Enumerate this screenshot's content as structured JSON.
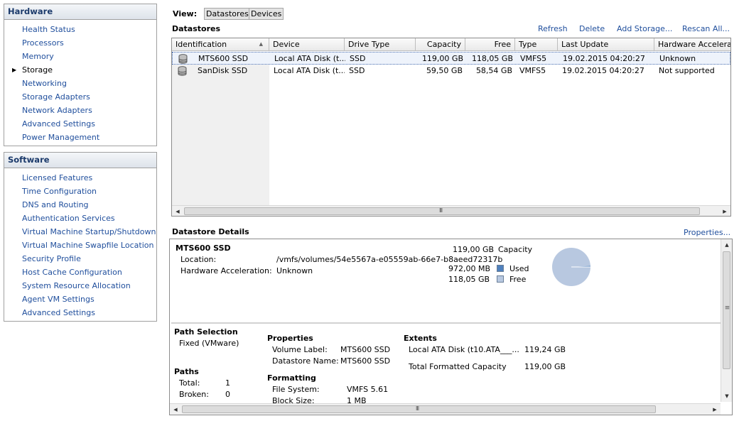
{
  "colors": {
    "link": "#1f4e9c",
    "used": "#4f81bd",
    "free": "#b8c8e0",
    "pie": "#b8c8e0"
  },
  "hardware": {
    "title": "Hardware",
    "items": [
      {
        "label": "Health Status"
      },
      {
        "label": "Processors"
      },
      {
        "label": "Memory"
      },
      {
        "label": "Storage",
        "active": true
      },
      {
        "label": "Networking"
      },
      {
        "label": "Storage Adapters"
      },
      {
        "label": "Network Adapters"
      },
      {
        "label": "Advanced Settings"
      },
      {
        "label": "Power Management"
      }
    ]
  },
  "software": {
    "title": "Software",
    "items": [
      {
        "label": "Licensed Features"
      },
      {
        "label": "Time Configuration"
      },
      {
        "label": "DNS and Routing"
      },
      {
        "label": "Authentication Services"
      },
      {
        "label": "Virtual Machine Startup/Shutdown"
      },
      {
        "label": "Virtual Machine Swapfile Location"
      },
      {
        "label": "Security Profile"
      },
      {
        "label": "Host Cache Configuration"
      },
      {
        "label": "System Resource Allocation"
      },
      {
        "label": "Agent VM Settings"
      },
      {
        "label": "Advanced Settings"
      }
    ]
  },
  "view": {
    "label": "View:",
    "datastores": "Datastores",
    "devices": "Devices"
  },
  "datastores": {
    "title": "Datastores",
    "actions": {
      "refresh": "Refresh",
      "delete": "Delete",
      "add_storage": "Add Storage...",
      "rescan": "Rescan All..."
    },
    "columns": [
      "Identification",
      "Device",
      "Drive Type",
      "Capacity",
      "Free",
      "Type",
      "Last Update",
      "Hardware Accelerat"
    ],
    "rows": [
      [
        "MTS600 SSD",
        "Local ATA Disk (t...",
        "SSD",
        "119,00 GB",
        "118,05 GB",
        "VMFS5",
        "19.02.2015 04:20:27",
        "Unknown"
      ],
      [
        "SanDisk SSD",
        "Local ATA Disk (t...",
        "SSD",
        "59,50 GB",
        "58,54 GB",
        "VMFS5",
        "19.02.2015 04:20:27",
        "Not supported"
      ]
    ],
    "scroll_grip": "III"
  },
  "details": {
    "title": "Datastore Details",
    "properties_link": "Properties...",
    "name": "MTS600 SSD",
    "location_label": "Location:",
    "location_value": "/vmfs/volumes/54e5567a-e05559ab-66e7-b8aeed72317b",
    "hwaccel_label": "Hardware Acceleration:",
    "hwaccel_value": "Unknown",
    "capacity_value": "119,00 GB",
    "capacity_label": "Capacity",
    "used_value": "972,00 MB",
    "used_label": "Used",
    "free_value": "118,05 GB",
    "free_label": "Free",
    "used_fraction": 0.008,
    "path_selection_title": "Path Selection",
    "path_selection_value": "Fixed (VMware)",
    "paths_title": "Paths",
    "total_label": "Total:",
    "total_value": "1",
    "broken_label": "Broken:",
    "broken_value": "0",
    "properties_title": "Properties",
    "volume_label_label": "Volume Label:",
    "volume_label_value": "MTS600 SSD",
    "datastore_name_label": "Datastore Name:",
    "datastore_name_value": "MTS600 SSD",
    "formatting_title": "Formatting",
    "file_system_label": "File System:",
    "file_system_value": "VMFS 5.61",
    "block_size_label": "Block Size:",
    "block_size_value": "1 MB",
    "extents_title": "Extents",
    "extent_name": "Local ATA Disk (t10.ATA___...",
    "extent_size": "119,24 GB",
    "total_formatted_label": "Total Formatted Capacity",
    "total_formatted_value": "119,00 GB",
    "vscroll_grip": "≡",
    "hscroll_grip": "III"
  }
}
